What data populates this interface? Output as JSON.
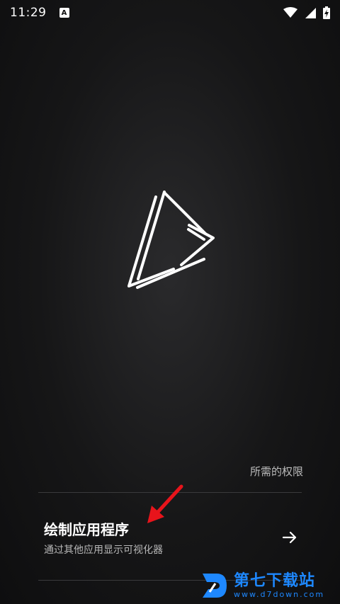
{
  "status_bar": {
    "time": "11:29",
    "app_indicator": "A",
    "icons": [
      "wifi-icon",
      "signal-icon",
      "battery-charging-icon"
    ]
  },
  "logo": {
    "icon": "play-triangle-logo-icon"
  },
  "permissions": {
    "heading": "所需的权限",
    "items": [
      {
        "title": "绘制应用程序",
        "description": "通过其他应用显示可视化器",
        "icon": "arrow-right-icon"
      }
    ]
  },
  "annotation": {
    "icon": "red-pointer-arrow-icon",
    "color": "#e8141b"
  },
  "watermark": {
    "text": "第七下载站",
    "url": "www.d7down.com",
    "color": "#1e88ff"
  }
}
